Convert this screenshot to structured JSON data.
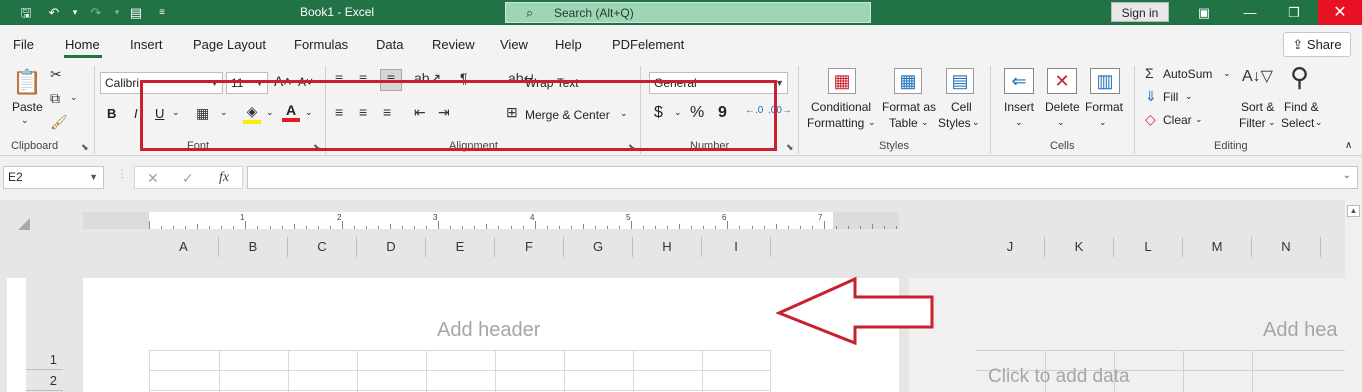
{
  "titlebar": {
    "doc_title": "Book1  -  Excel",
    "search_placeholder": "Search (Alt+Q)",
    "signin_label": "Sign in",
    "close_glyph": "✕"
  },
  "menu": {
    "tabs": [
      "File",
      "Home",
      "Insert",
      "Page Layout",
      "Formulas",
      "Data",
      "Review",
      "View",
      "Help",
      "PDFelement"
    ],
    "active_tab": "Home",
    "share_label": "Share"
  },
  "ribbon": {
    "clipboard": {
      "paste": "Paste",
      "label": "Clipboard"
    },
    "font": {
      "name": "Calibri",
      "size": "11",
      "bold": "B",
      "italic": "I",
      "underline": "U",
      "label": "Font"
    },
    "alignment": {
      "wrap_text": "Wrap Text",
      "merge_center": "Merge & Center",
      "label": "Alignment"
    },
    "number": {
      "format": "General",
      "currency": "$",
      "percent": "%",
      "comma": "9",
      "label": "Number"
    },
    "styles": {
      "conditional_formatting_1": "Conditional",
      "conditional_formatting_2": "Formatting",
      "format_table_1": "Format as",
      "format_table_2": "Table",
      "cell_styles_1": "Cell",
      "cell_styles_2": "Styles",
      "label": "Styles"
    },
    "cells": {
      "insert": "Insert",
      "delete": "Delete",
      "format": "Format",
      "label": "Cells"
    },
    "editing": {
      "autosum": "AutoSum",
      "fill": "Fill",
      "clear": "Clear",
      "sort_filter_1": "Sort &",
      "sort_filter_2": "Filter",
      "find_select_1": "Find &",
      "find_select_2": "Select",
      "label": "Editing"
    }
  },
  "formula_bar": {
    "name_box": "E2",
    "cancel": "✕",
    "enter": "✓",
    "fx": "fx",
    "formula_value": ""
  },
  "sheet": {
    "ruler_numbers": [
      "1",
      "2",
      "3",
      "4",
      "5",
      "6",
      "7"
    ],
    "columns_page1": [
      "A",
      "B",
      "C",
      "D",
      "E",
      "F",
      "G",
      "H",
      "I"
    ],
    "columns_page2": [
      "J",
      "K",
      "L",
      "M",
      "N"
    ],
    "rows": [
      "1",
      "2"
    ],
    "header_placeholder": "Add header",
    "header_placeholder_page2": "Add hea",
    "click_to_add": "Click to add data"
  },
  "colors": {
    "title_green": "#217346",
    "search_bg": "#9fd5b7",
    "close_red": "#e81123",
    "annotation_red": "#c8202e"
  }
}
